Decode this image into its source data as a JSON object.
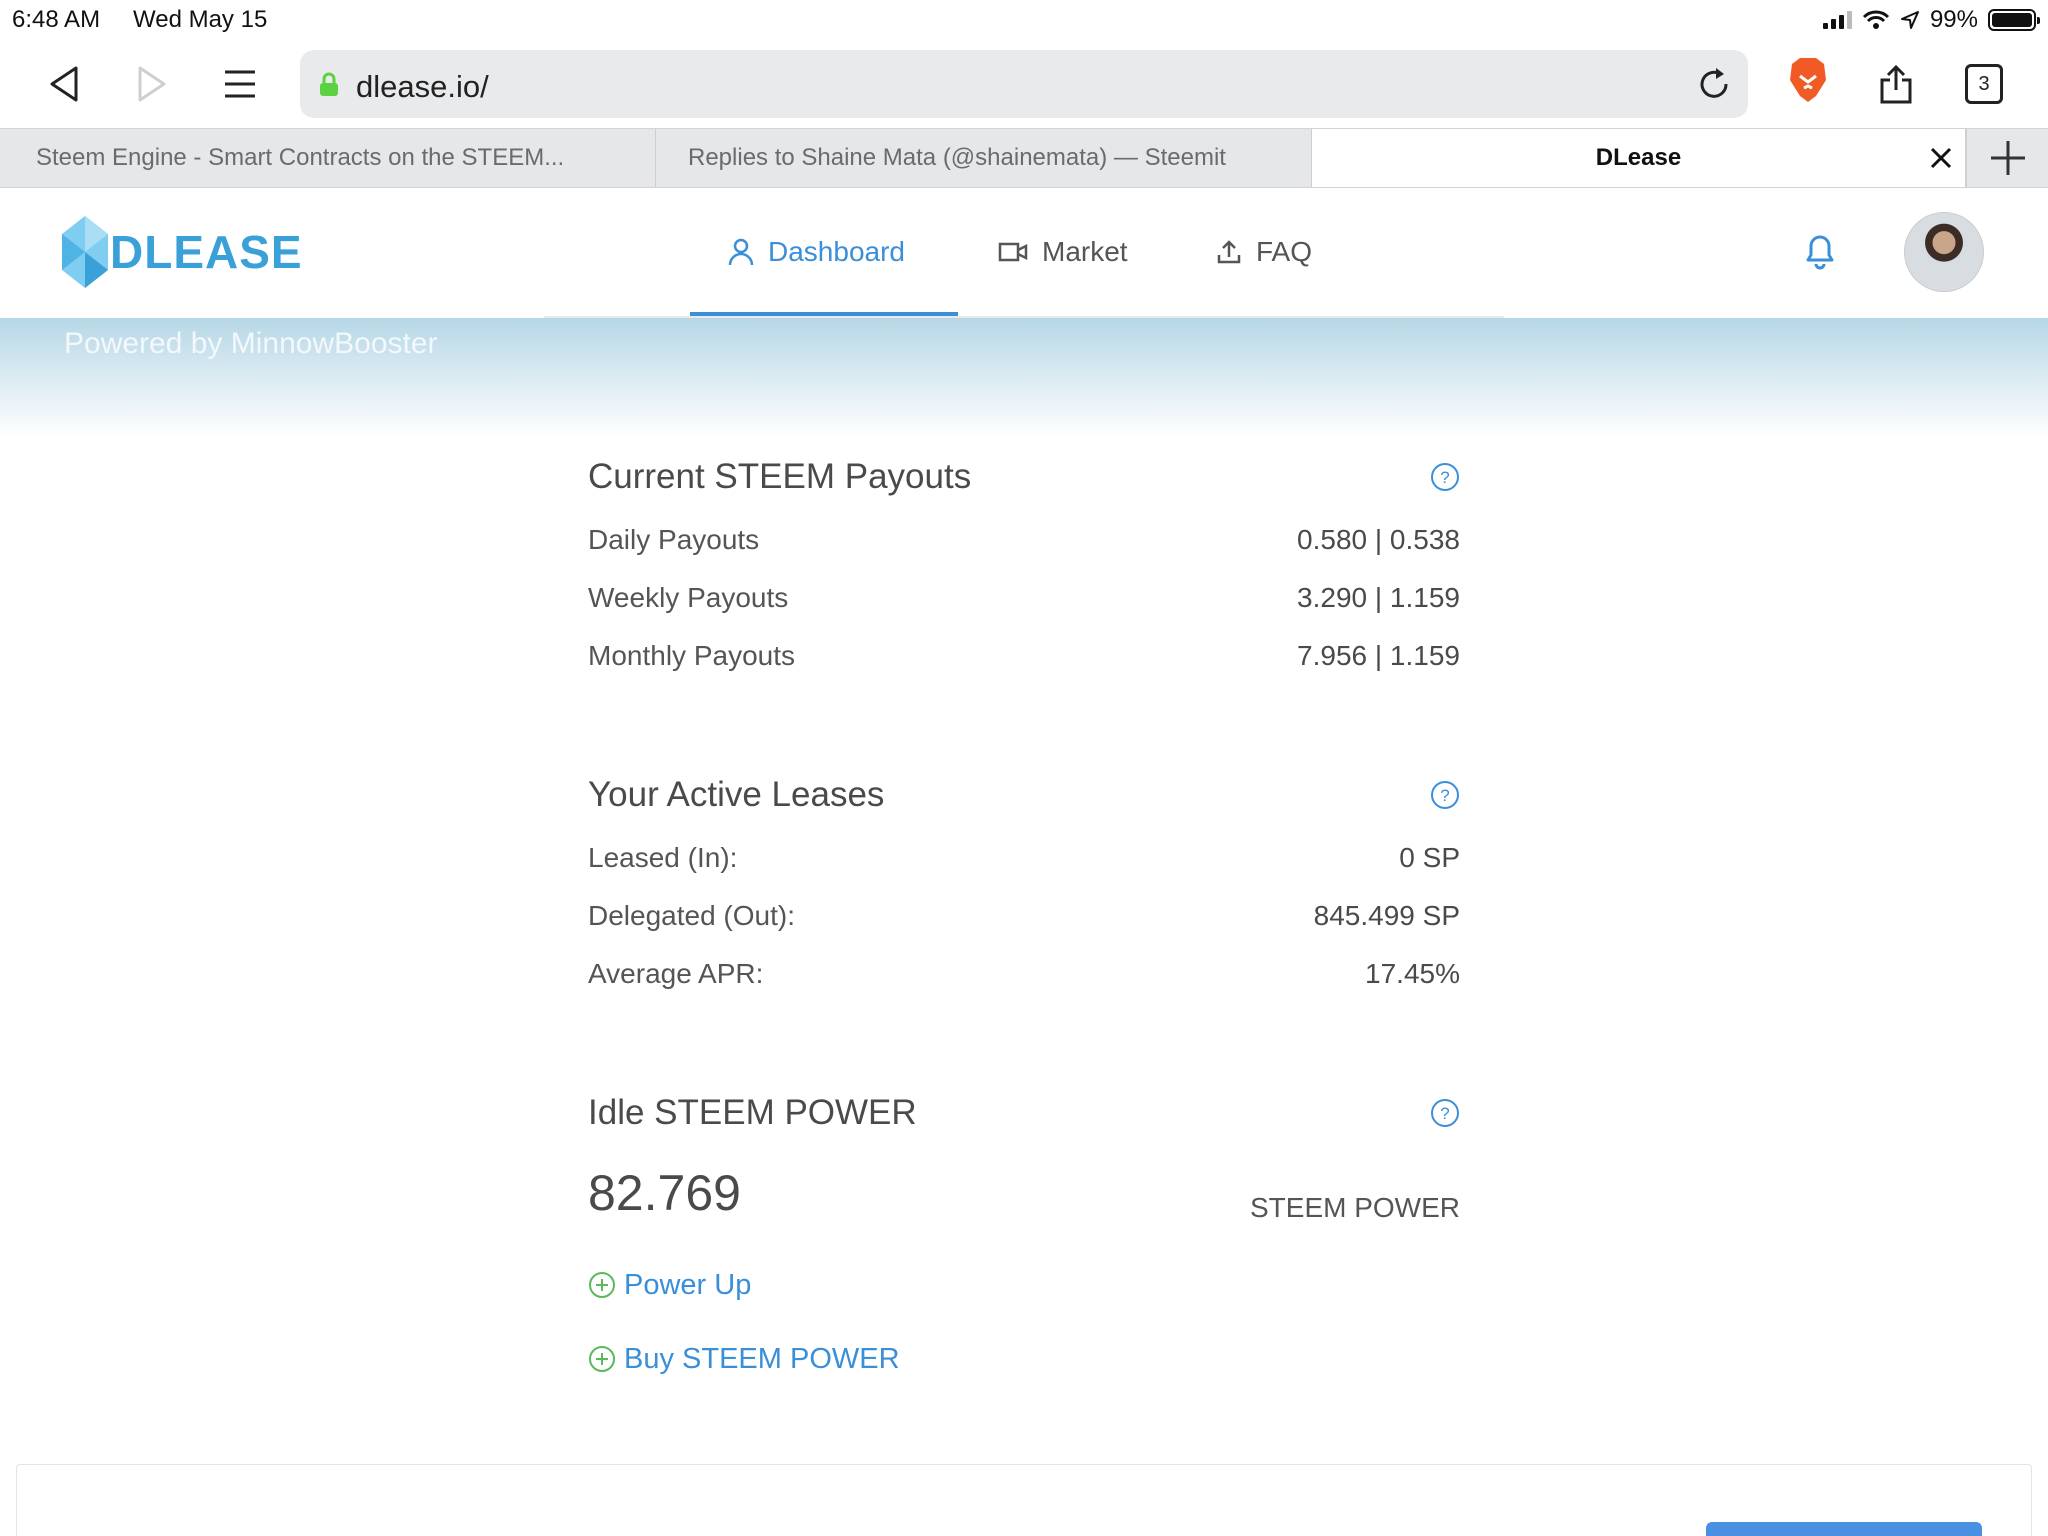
{
  "status_bar": {
    "time": "6:48 AM",
    "date": "Wed May 15",
    "battery": "99%"
  },
  "browser": {
    "url": "dlease.io/",
    "tab_count": "3",
    "tabs": [
      {
        "title": "Steem Engine - Smart Contracts on the STEEM..."
      },
      {
        "title": "Replies to Shaine Mata (@shainemata) — Steemit"
      },
      {
        "title": "DLease"
      }
    ]
  },
  "site": {
    "logo_text": "DLEASE",
    "nav": [
      {
        "label": "Dashboard",
        "icon": "user-icon"
      },
      {
        "label": "Market",
        "icon": "video-icon"
      },
      {
        "label": "FAQ",
        "icon": "upload-icon"
      }
    ],
    "banner_text": "Powered by MinnowBooster"
  },
  "payouts": {
    "title": "Current STEEM Payouts",
    "rows": [
      {
        "label": "Daily Payouts",
        "value": "0.580 | 0.538"
      },
      {
        "label": "Weekly Payouts",
        "value": "3.290 | 1.159"
      },
      {
        "label": "Monthly Payouts",
        "value": "7.956 | 1.159"
      }
    ]
  },
  "leases": {
    "title": "Your Active Leases",
    "rows": [
      {
        "label": "Leased (In):",
        "value": "0 SP"
      },
      {
        "label": "Delegated (Out):",
        "value": "845.499 SP"
      },
      {
        "label": "Average APR:",
        "value": "17.45%"
      }
    ]
  },
  "idle": {
    "title": "Idle STEEM POWER",
    "amount": "82.769",
    "unit": "STEEM POWER",
    "actions": [
      {
        "label": "Power Up"
      },
      {
        "label": "Buy STEEM POWER"
      }
    ]
  },
  "colors": {
    "accent": "#3a8fd8",
    "plus_icon": "#5cb85c",
    "brave": "#f15a24"
  }
}
